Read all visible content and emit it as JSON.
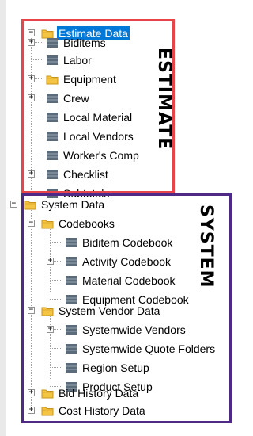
{
  "tree": {
    "estimate": {
      "label": "Estimate Data",
      "children": [
        "Biditems",
        "Labor",
        "Equipment",
        "Crew",
        "Local Material",
        "Local Vendors",
        "Worker's Comp",
        "Checklist",
        "Subtotals"
      ]
    },
    "system": {
      "label": "System Data",
      "codebooks": {
        "label": "Codebooks",
        "children": [
          "Biditem Codebook",
          "Activity Codebook",
          "Material Codebook",
          "Equipment Codebook"
        ]
      },
      "vendor": {
        "label": "System Vendor Data",
        "children": [
          "Systemwide Vendors",
          "Systemwide Quote Folders",
          "Region Setup",
          "Product Setup"
        ]
      },
      "bid_history": "Bid History Data",
      "cost_history": "Cost History Data"
    }
  },
  "annotations": {
    "estimate": "ESTIMATE",
    "system": "SYSTEM"
  },
  "colors": {
    "selection": "#0078d7",
    "estimate_box": "#e8454a",
    "system_box": "#4e2a86",
    "folder": "#f4c542",
    "item_icon": "#5b6b7a"
  },
  "icons": {
    "folder": "folder-icon",
    "item": "table-icon",
    "expand": "plus-icon",
    "collapse": "minus-icon"
  }
}
